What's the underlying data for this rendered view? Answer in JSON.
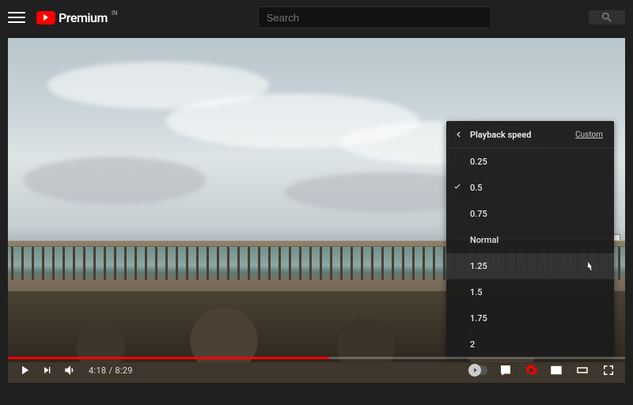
{
  "header": {
    "brand": "Premium",
    "country": "IN",
    "search_placeholder": "Search"
  },
  "player": {
    "time_current": "4:18",
    "time_total": "8:29",
    "progress_percent": 52
  },
  "speed_menu": {
    "title": "Playback speed",
    "custom_label": "Custom",
    "selected": "0.5",
    "hovered": "1.25",
    "options": [
      "0.25",
      "0.5",
      "0.75",
      "Normal",
      "1.25",
      "1.5",
      "1.75",
      "2"
    ]
  }
}
